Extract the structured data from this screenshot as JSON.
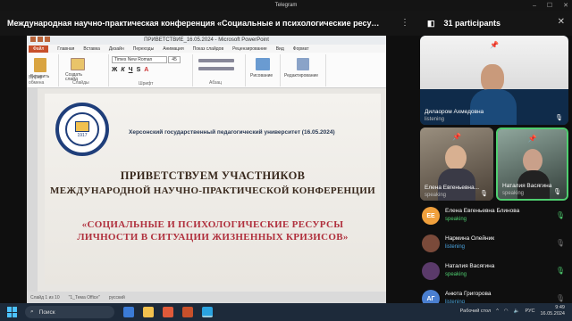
{
  "window": {
    "title": "Telegram"
  },
  "header": {
    "call_title": "Международная научно-практическая конференция «Социальные и психологические ресурсы личности ..."
  },
  "sidebar": {
    "participants_label": "31 participants"
  },
  "presentation": {
    "window_title": "ПРИВЕТСТВИЕ_16.05.2024 - Microsoft PowerPoint",
    "tabs": [
      "Файл",
      "Главная",
      "Вставка",
      "Дизайн",
      "Переходы",
      "Анимация",
      "Показ слайдов",
      "Рецензирование",
      "Вид",
      "Формат"
    ],
    "font_name": "Times New Roman",
    "font_size": "45",
    "groups": [
      "Буфер обмена",
      "Слайды",
      "Шрифт",
      "Абзац",
      "Рисование",
      "Редактирование"
    ],
    "buttons": {
      "paste": "Вставить",
      "create_slide": "Создать слайд",
      "drawing": "Рисование",
      "editing": "Редактирование"
    },
    "slide": {
      "university": "Херсонский государственный педагогический университет (16.05.2024)",
      "logo_year": "1917",
      "line1": "ПРИВЕТСТВУЕМ УЧАСТНИКОВ",
      "line2": "МЕЖДУНАРОДНОЙ НАУЧНО-ПРАКТИЧЕСКОЙ КОНФЕРЕНЦИИ",
      "line3": "«СОЦИАЛЬНЫЕ И ПСИХОЛОГИЧЕСКИЕ РЕСУРСЫ ЛИЧНОСТИ В СИТУАЦИИ ЖИЗНЕННЫХ КРИЗИСОВ»"
    },
    "status": {
      "slide": "Слайд 1 из 10",
      "theme": "\"1_Тема Office\"",
      "lang": "русский"
    }
  },
  "video_tiles": [
    {
      "name": "Дилаором Ахмедовна",
      "status": "listening"
    },
    {
      "name": "Елена Евгеньевна...",
      "status": "speaking"
    },
    {
      "name": "Наталия Васягина",
      "status": "speaking"
    }
  ],
  "participants": [
    {
      "initials": "ЕЕ",
      "name": "Елена Евгеньевна Блинова",
      "status": "speaking",
      "color": "#f0a03c"
    },
    {
      "initials": "",
      "name": "Нармина Олейник",
      "status": "listening",
      "color": "#7a4a3a"
    },
    {
      "initials": "",
      "name": "Наталия Васягина",
      "status": "speaking",
      "color": "#5a3a6a"
    },
    {
      "initials": "АГ",
      "name": "Анюта Григорова",
      "status": "listening",
      "color": "#4a7fd0"
    }
  ],
  "taskbar": {
    "search_label": "Поиск",
    "keyboard": "РУС",
    "time": "9:49",
    "date": "16.05.2024",
    "weather": "Рабочий стол"
  },
  "colors": {
    "accent": "#4aa3df",
    "speaking": "#4fcf70",
    "slide_red": "#b0303d"
  }
}
